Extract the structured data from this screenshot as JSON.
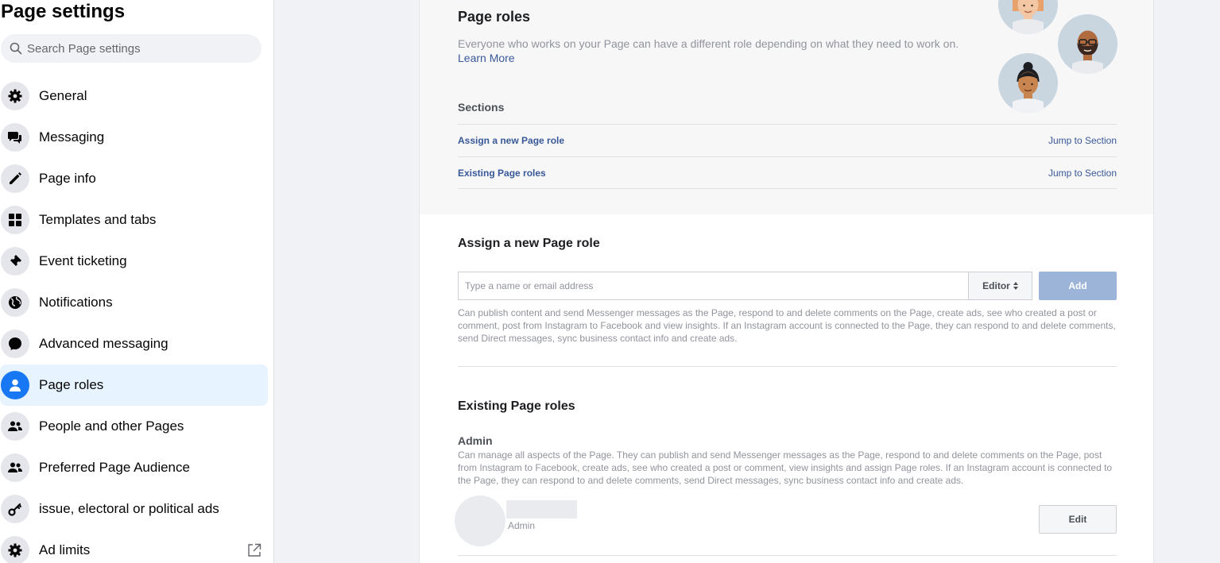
{
  "sidebar": {
    "title": "Page settings",
    "search_placeholder": "Search Page settings",
    "items": [
      {
        "label": "General",
        "icon": "gear-icon"
      },
      {
        "label": "Messaging",
        "icon": "chat-bubbles-icon"
      },
      {
        "label": "Page info",
        "icon": "pencil-icon"
      },
      {
        "label": "Templates and tabs",
        "icon": "grid-icon"
      },
      {
        "label": "Event ticketing",
        "icon": "ticket-icon"
      },
      {
        "label": "Notifications",
        "icon": "globe-icon"
      },
      {
        "label": "Advanced messaging",
        "icon": "messenger-icon"
      },
      {
        "label": "Page roles",
        "icon": "person-icon",
        "active": true
      },
      {
        "label": "People and other Pages",
        "icon": "people-icon"
      },
      {
        "label": "Preferred Page Audience",
        "icon": "people-icon"
      },
      {
        "label": "issue, electoral or political ads",
        "icon": "key-icon"
      },
      {
        "label": "Ad limits",
        "icon": "gear-icon",
        "external": true
      }
    ]
  },
  "main": {
    "title": "Page roles",
    "description": "Everyone who works on your Page can have a different role depending on what they need to work on.",
    "learn_more": "Learn More",
    "sections_heading": "Sections",
    "sections": [
      {
        "label": "Assign a new Page role",
        "jump": "Jump to Section"
      },
      {
        "label": "Existing Page roles",
        "jump": "Jump to Section"
      }
    ],
    "assign": {
      "heading": "Assign a new Page role",
      "input_placeholder": "Type a name or email address",
      "role_value": "Editor",
      "add_label": "Add",
      "role_description": "Can publish content and send Messenger messages as the Page, respond to and delete comments on the Page, create ads, see who created a post or comment, post from Instagram to Facebook and view insights. If an Instagram account is connected to the Page, they can respond to and delete comments, send Direct messages, sync business contact info and create ads."
    },
    "existing": {
      "heading": "Existing Page roles",
      "role_title": "Admin",
      "role_description": "Can manage all aspects of the Page. They can publish and send Messenger messages as the Page, respond to and delete comments on the Page, post from Instagram to Facebook, create ads, see who created a post or comment, view insights and assign Page roles. If an Instagram account is connected to the Page, they can respond to and delete comments, send Direct messages, sync business contact info and create ads.",
      "user_role": "Admin",
      "edit_label": "Edit"
    }
  },
  "colors": {
    "accent": "#1877f2",
    "link": "#385898",
    "active_bg": "#e7f3ff",
    "add_disabled": "#9cb4d8"
  }
}
